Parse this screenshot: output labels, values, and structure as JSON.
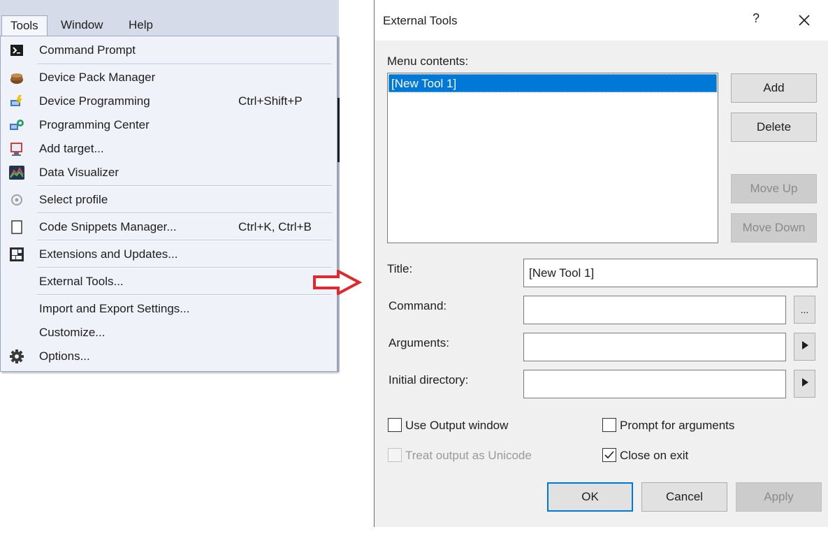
{
  "menubar": {
    "items": [
      "Tools",
      "Window",
      "Help"
    ]
  },
  "tools_menu": {
    "items": [
      {
        "label": "Command Prompt",
        "shortcut": "",
        "icon": "command-prompt-icon"
      },
      {
        "label": "Device Pack Manager",
        "shortcut": "",
        "icon": "device-pack-icon"
      },
      {
        "label": "Device Programming",
        "shortcut": "Ctrl+Shift+P",
        "icon": "device-programming-icon"
      },
      {
        "label": "Programming Center",
        "shortcut": "",
        "icon": "programming-center-icon"
      },
      {
        "label": "Add target...",
        "shortcut": "",
        "icon": "add-target-icon"
      },
      {
        "label": "Data Visualizer",
        "shortcut": "",
        "icon": "data-visualizer-icon"
      },
      {
        "label": "Select profile",
        "shortcut": "",
        "icon": "select-profile-icon"
      },
      {
        "label": "Code Snippets Manager...",
        "shortcut": "Ctrl+K, Ctrl+B",
        "icon": "code-snippets-icon"
      },
      {
        "label": "Extensions and Updates...",
        "shortcut": "",
        "icon": "extensions-icon"
      },
      {
        "label": "External Tools...",
        "shortcut": "",
        "icon": ""
      },
      {
        "label": "Import and Export Settings...",
        "shortcut": "",
        "icon": ""
      },
      {
        "label": "Customize...",
        "shortcut": "",
        "icon": ""
      },
      {
        "label": "Options...",
        "shortcut": "",
        "icon": "gear-icon"
      }
    ]
  },
  "dialog": {
    "title": "External Tools",
    "help_label": "?",
    "menu_contents_label": "Menu contents:",
    "list_items": [
      "[New Tool 1]"
    ],
    "selected_item": "[New Tool 1]",
    "buttons": {
      "add": "Add",
      "delete": "Delete",
      "move_up": "Move Up",
      "move_down": "Move Down",
      "browse": "...",
      "ok": "OK",
      "cancel": "Cancel",
      "apply": "Apply"
    },
    "fields": {
      "title_label": "Title:",
      "title_value": "[New Tool 1]",
      "command_label": "Command:",
      "command_value": "",
      "arguments_label": "Arguments:",
      "arguments_value": "",
      "initial_directory_label": "Initial directory:",
      "initial_directory_value": ""
    },
    "checkboxes": {
      "use_output_window": {
        "label": "Use Output window",
        "checked": false,
        "enabled": true
      },
      "prompt_for_arguments": {
        "label": "Prompt for arguments",
        "checked": false,
        "enabled": true
      },
      "treat_output_unicode": {
        "label": "Treat output as Unicode",
        "checked": false,
        "enabled": false
      },
      "close_on_exit": {
        "label": "Close on exit",
        "checked": true,
        "enabled": true
      }
    }
  },
  "colors": {
    "selection": "#0078d7",
    "arrow": "#e0282e",
    "menu_background": "#f0f2fa",
    "menubar_background": "#d6dbe9"
  }
}
